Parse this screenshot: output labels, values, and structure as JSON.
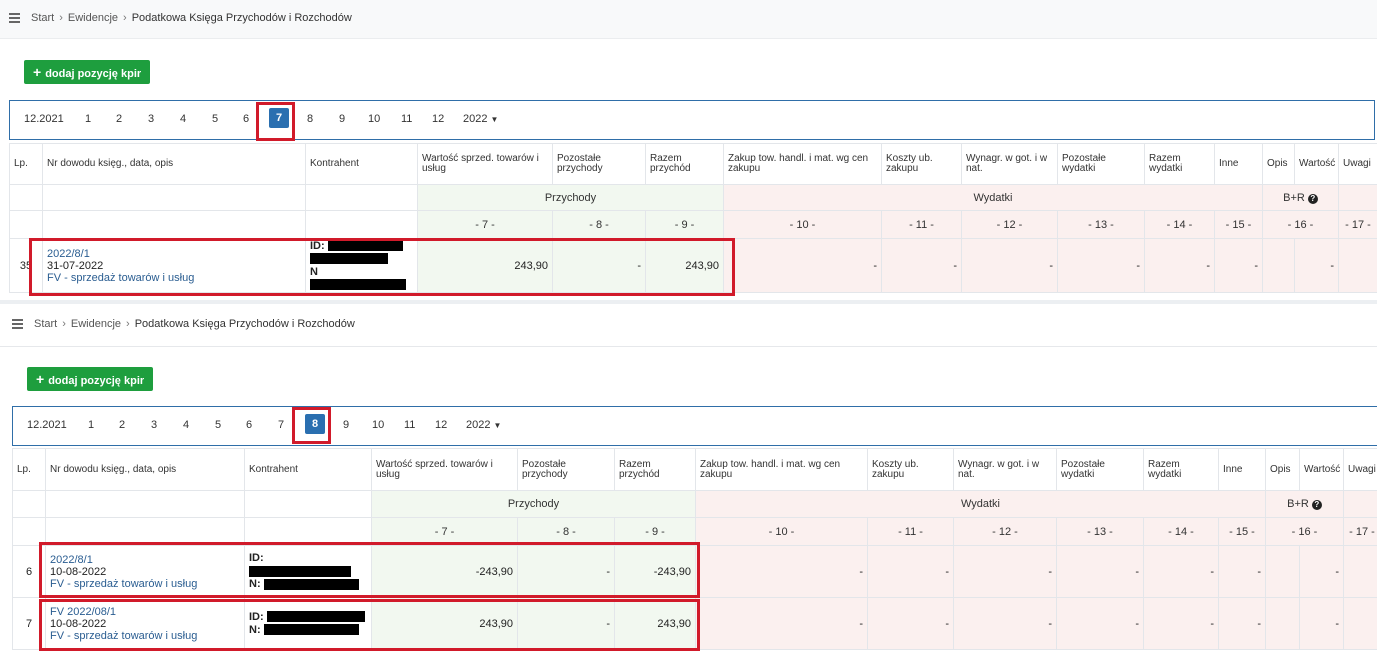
{
  "breadcrumb": {
    "start": "Start",
    "ewidencja": "Ewidencje",
    "current": "Podatkowa Księga Przychodów i Rozchodów"
  },
  "add_button": "dodaj pozycję kpir",
  "months": [
    "12.2021",
    "1",
    "2",
    "3",
    "4",
    "5",
    "6",
    "7",
    "8",
    "9",
    "10",
    "11",
    "12"
  ],
  "year_select": "2022",
  "headers": {
    "lp": "Lp.",
    "nr": "Nr dowodu księg., data, opis",
    "kontrahent": "Kontrahent",
    "c7": "Wartość sprzed. towarów i usług",
    "c8": "Pozostałe przychody",
    "c9": "Razem przychód",
    "c10": "Zakup tow. handl. i mat. wg cen zakupu",
    "c11": "Koszty ub. zakupu",
    "c12": "Wynagr. w got. i w nat.",
    "c13": "Pozostałe wydatki",
    "c14": "Razem wydatki",
    "c15": "Inne",
    "opis": "Opis",
    "wartosc": "Wartość",
    "uwagi": "Uwagi",
    "przychody": "Przychody",
    "wydatki": "Wydatki",
    "br": "B+R",
    "n7": "- 7 -",
    "n8": "- 8 -",
    "n9": "- 9 -",
    "n10": "- 10 -",
    "n11": "- 11 -",
    "n12": "- 12 -",
    "n13": "- 13 -",
    "n14": "- 14 -",
    "n15": "- 15 -",
    "n16": "- 16 -",
    "n17": "- 17 -"
  },
  "id_label": "ID:",
  "n_label": "N:",
  "n_label_clipped": "N",
  "dash": "-",
  "top": {
    "active_month": "7",
    "rows": [
      {
        "lp": "35",
        "doc": "2022/8/1",
        "date": "31-07-2022",
        "desc": "FV - sprzedaż towarów i usług",
        "c7": "243,90",
        "c8": "-",
        "c9": "243,90"
      }
    ]
  },
  "bottom": {
    "active_month": "8",
    "rows": [
      {
        "lp": "6",
        "doc": "2022/8/1",
        "date": "10-08-2022",
        "desc": "FV - sprzedaż towarów i usług",
        "c7": "-243,90",
        "c8": "-",
        "c9": "-243,90"
      },
      {
        "lp": "7",
        "doc": "FV 2022/08/1",
        "date": "10-08-2022",
        "desc": "FV - sprzedaż towarów i usług",
        "c7": "243,90",
        "c8": "-",
        "c9": "243,90"
      }
    ]
  },
  "colors": {
    "accent": "#2a6fb0",
    "add_button": "#1e9e3e",
    "highlight": "#d11a2a",
    "income_bg": "#f2f8f0",
    "expense_bg": "#fbf0ef"
  }
}
